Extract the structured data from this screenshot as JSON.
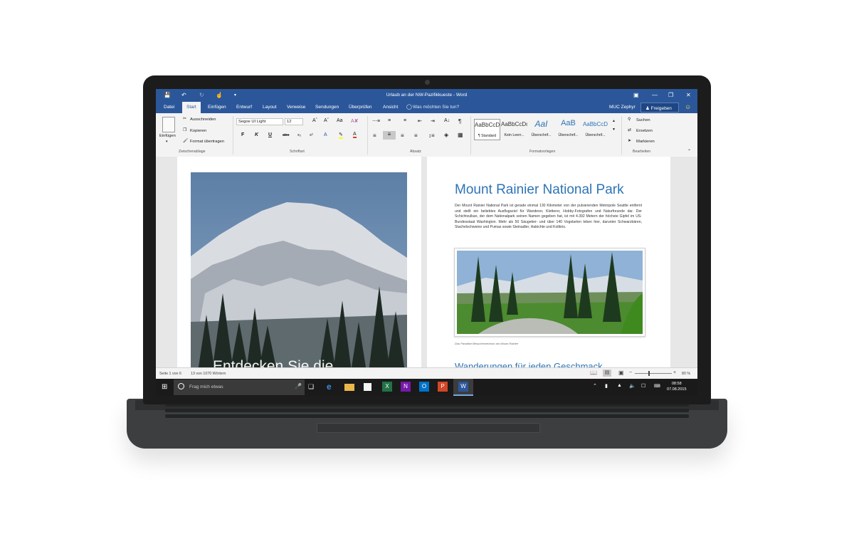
{
  "window": {
    "title": "Urlaub an der NW-Pazifikkueste - Word"
  },
  "tabs": [
    "Datei",
    "Start",
    "Einfügen",
    "Entwurf",
    "Layout",
    "Verweise",
    "Sendungen",
    "Überprüfen",
    "Ansicht"
  ],
  "tell_me": "Was möchten Sie tun?",
  "user": "MUC Zephyr",
  "share_label": "Freigeben",
  "ribbon": {
    "clipboard": {
      "paste": "Einfügen",
      "cut": "Ausschneiden",
      "copy": "Kopieren",
      "format_painter": "Format übertragen",
      "label": "Zwischenablage"
    },
    "font": {
      "name": "Segoe UI Light",
      "size": "12",
      "bold": "F",
      "italic": "K",
      "underline": "U",
      "strike": "abc",
      "sub": "x₂",
      "sup": "x²",
      "label": "Schriftart"
    },
    "paragraph": {
      "label": "Absatz"
    },
    "styles": {
      "items": [
        {
          "preview": "AaBbCcD",
          "label": "¶ Standard"
        },
        {
          "preview": "AaBbCcDc",
          "label": "Kein Leerr..."
        },
        {
          "preview": "AaI",
          "label": "Überschrif..."
        },
        {
          "preview": "AaB",
          "label": "Überschrif..."
        },
        {
          "preview": "AaBbCcD",
          "label": "Überschrif..."
        }
      ],
      "label": "Formatvorlagen"
    },
    "editing": {
      "find": "Suchen",
      "replace": "Ersetzen",
      "select": "Markieren",
      "label": "Bearbeiten"
    }
  },
  "document": {
    "cover_text": "Entdecken Sie die",
    "heading": "Mount Rainier National Park",
    "body": "Der Mount Rainier National Park ist gerade einmal 130 Kilometer von der pulsierenden Metropole Seattle entfernt und stellt ein beliebtes Ausflugsziel für Wanderer, Kletterer, Hobby-Fotografen und Naturfreunde dar. Der Schichtvulkan, der dem Nationalpark seinen Namen gegeben hat, ist mit 4.392 Metern der höchste Gipfel im US-Bundesstaat Washington. Mehr als 50 Säugetier- und über 140 Vogelarten leben hier, darunter Schwarzbären, Stachelschweine und Pumas sowie Steinadler, Habichte und Kolibris.",
    "caption": "Das Paradise Besucherzentrum am Mount Rainier",
    "subheading": "Wanderungen für jeden Geschmack"
  },
  "status": {
    "page": "Seite 1 von 6",
    "words": "13 von 1070 Wörtern",
    "zoom": "80 %"
  },
  "taskbar": {
    "search_placeholder": "Frag mich etwas",
    "time": "08:58",
    "date": "07.08.2015"
  },
  "colors": {
    "word_blue": "#2b579a",
    "heading_blue": "#2e74b5"
  }
}
